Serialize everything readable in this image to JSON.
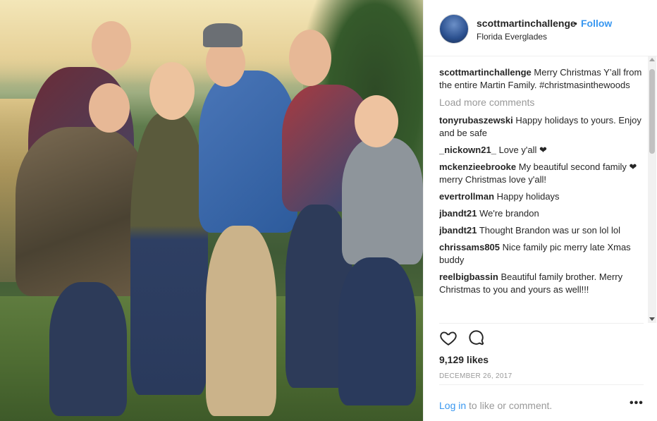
{
  "post": {
    "username": "scottmartinchallenge",
    "separator": "•",
    "follow_label": "Follow",
    "location": "Florida Everglades",
    "caption_username": "scottmartinchallenge",
    "caption_text": "Merry Christmas Y’all from the entire Martin Family. #christmasinthewoods",
    "load_more": "Load more comments",
    "comments": [
      {
        "user": "tonyrubaszewski",
        "text": "Happy holidays to yours. Enjoy and be safe"
      },
      {
        "user": "_nickown21_",
        "text": "Love y'all ❤"
      },
      {
        "user": "mckenzieebrooke",
        "text": "My beautiful second family ❤ merry Christmas love y'all!"
      },
      {
        "user": "evertrollman",
        "text": "Happy holidays"
      },
      {
        "user": "jbandt21",
        "text": "We're brandon"
      },
      {
        "user": "jbandt21",
        "text": "Thought Brandon was ur son lol lol"
      },
      {
        "user": "chrissams805",
        "text": "Nice family pic merry late Xmas buddy"
      },
      {
        "user": "reelbigbassin",
        "text": "Beautiful family brother. Merry Christmas to you and yours as well!!!"
      }
    ],
    "likes": "9,129 likes",
    "date": "DECEMBER 26, 2017",
    "login_link": "Log in",
    "login_rest": " to like or comment.",
    "more_menu": "•••"
  },
  "icons": {
    "like": "heart-icon",
    "comment": "comment-bubble-icon"
  },
  "colors": {
    "link_blue": "#3897f0",
    "muted_gray": "#999999",
    "text": "#262626",
    "border": "#efefef"
  }
}
